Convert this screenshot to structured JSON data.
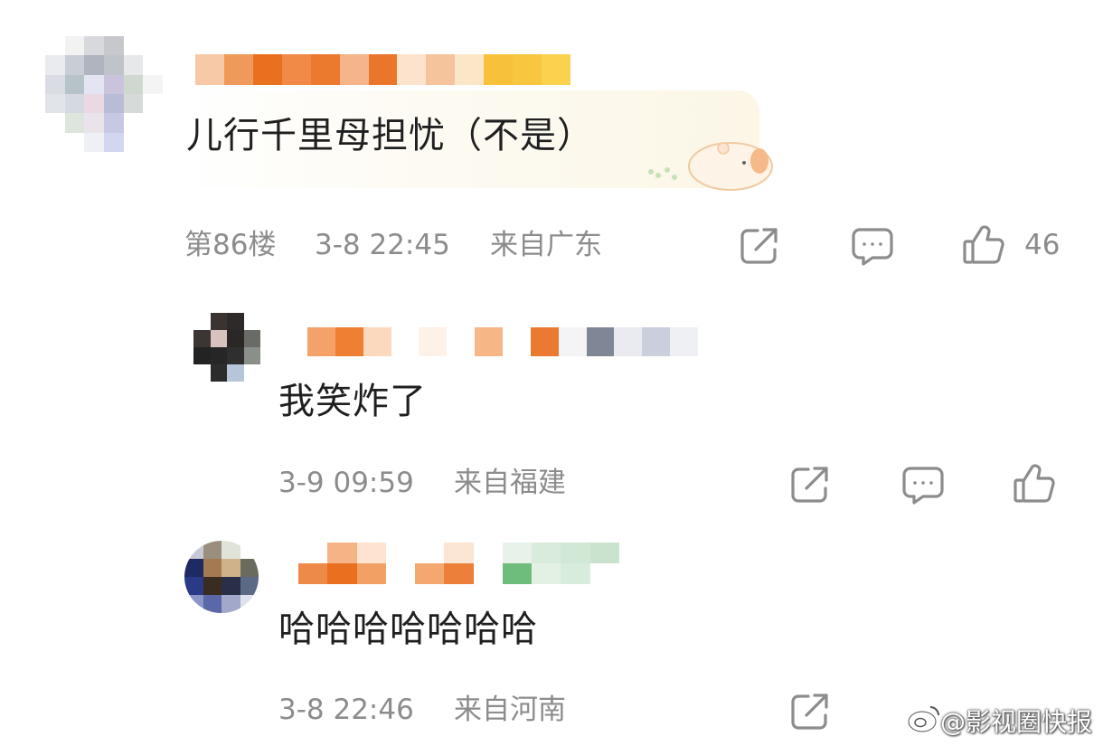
{
  "comments": [
    {
      "text": "儿行千里母担忧（不是）",
      "floor": "第86楼",
      "time": "3-8 22:45",
      "location": "来自广东",
      "likes": "46"
    },
    {
      "text": "我笑炸了",
      "time": "3-9 09:59",
      "location": "来自福建"
    },
    {
      "text": "哈哈哈哈哈哈哈",
      "time": "3-8 22:46",
      "location": "来自河南"
    }
  ],
  "icons": {
    "share": "share-icon",
    "comment": "comment-icon",
    "like": "thumbs-up-icon",
    "bubble_decoration": "hamster-sticker-icon",
    "watermark_logo": "weibo-logo-icon"
  },
  "watermark": "@影视圈快报",
  "colors": {
    "meta_text": "#8c8c8c",
    "icon_stroke": "#8c8c8c",
    "username_orange": "#e8701e",
    "bubble_tint": "#fbf6e6"
  }
}
